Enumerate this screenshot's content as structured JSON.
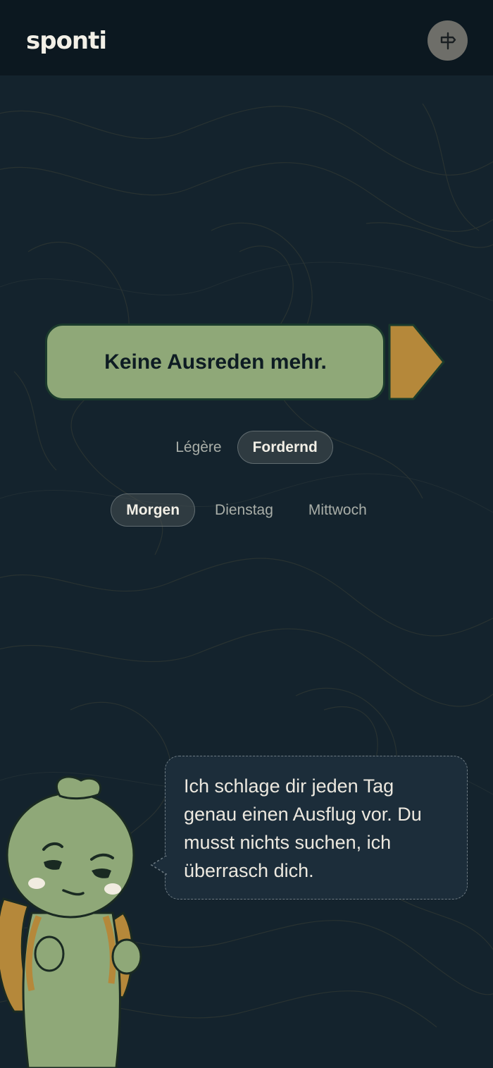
{
  "header": {
    "logo_text": "sponti",
    "signpost_icon": "signpost-icon"
  },
  "cta": {
    "label": "Keine Ausreden mehr.",
    "arrow_icon": "arrow-right-icon"
  },
  "mode_options": [
    {
      "label": "Légère",
      "selected": false
    },
    {
      "label": "Fordernd",
      "selected": true
    }
  ],
  "day_options": [
    {
      "label": "Morgen",
      "selected": true
    },
    {
      "label": "Dienstag",
      "selected": false
    },
    {
      "label": "Mittwoch",
      "selected": false
    }
  ],
  "speech": {
    "text": "Ich schlage dir jeden Tag genau einen Ausflug vor. Du musst nichts suchen, ich überrasch dich."
  },
  "colors": {
    "background": "#14232d",
    "header": "#0c1820",
    "accent_green": "#8fa878",
    "accent_ochre": "#b5883a",
    "bubble": "#1c2d3a"
  }
}
